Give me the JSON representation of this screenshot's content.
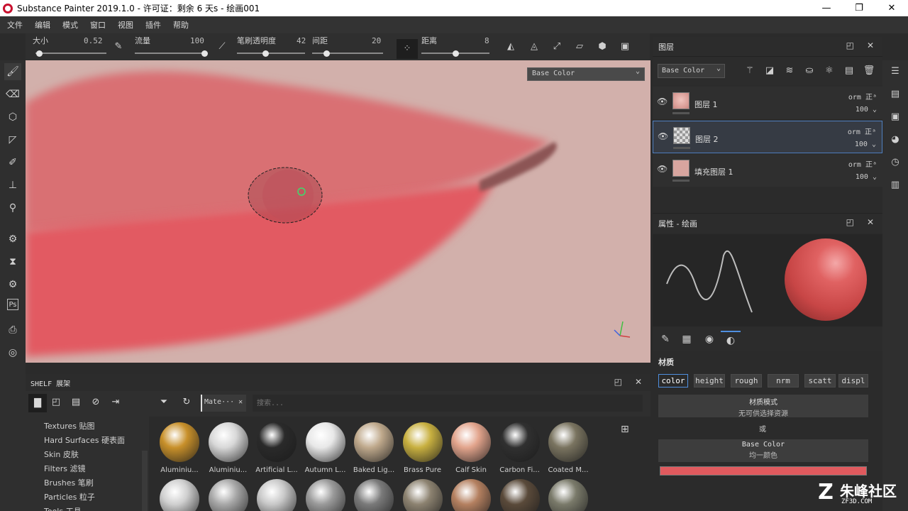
{
  "window": {
    "title": "Substance Painter 2019.1.0 - 许可证：剩余 6 天s - 绘画001",
    "minimize": "—",
    "restore": "❐",
    "close": "✕"
  },
  "menu": [
    "文件",
    "编辑",
    "模式",
    "窗口",
    "视图",
    "插件",
    "帮助"
  ],
  "toolbar": {
    "size_label": "大小",
    "size_value": "0.52",
    "flow_label": "流量",
    "flow_value": "100",
    "opacity_label": "笔刷透明度",
    "opacity_value": "42",
    "spacing_label": "间距",
    "spacing_value": "20",
    "distance_label": "距离",
    "distance_value": "8",
    "size_slider": 0.05,
    "flow_slider": 1.0,
    "opacity_slider": 0.42,
    "spacing_slider": 0.2,
    "distance_slider": 0.5
  },
  "viewport": {
    "channel": "Base Color"
  },
  "layers": {
    "title": "图层",
    "channel_select": "Base Color",
    "items": [
      {
        "name": "图层 1",
        "blend": "orm 正ᵃ",
        "opacity": "100 ⌄",
        "thumb": "face"
      },
      {
        "name": "图层 2",
        "blend": "orm 正ᵃ",
        "opacity": "100 ⌄",
        "thumb": "checker",
        "selected": true
      },
      {
        "name": "填充图层 1",
        "blend": "orm 正ᵃ",
        "opacity": "100 ⌄",
        "thumb": "face"
      }
    ]
  },
  "properties": {
    "title": "属性 - 绘画",
    "section": "材质",
    "channels": [
      "color",
      "height",
      "rough",
      "nrm",
      "scatt",
      "displ"
    ],
    "active_channel": "color",
    "material_mode_title": "材质模式",
    "material_mode_sub": "无可供选择资源",
    "or": "或",
    "base_color_title": "Base Color",
    "base_color_sub": "均一颜色",
    "swatch_color": "#e05a5e"
  },
  "shelf": {
    "title": "SHELF 展架",
    "filter_tag": "Mate··· ✕",
    "search_placeholder": "搜索...",
    "tree": [
      "Textures 贴图",
      "Hard Surfaces 硬表面",
      "Skin 皮肤",
      "Filters 滤镜",
      "Brushes 笔刷",
      "Particles 粒子",
      "Tools 工具"
    ],
    "assets_row1": [
      "Aluminiu...",
      "Aluminiu...",
      "Artificial L...",
      "Autumn L...",
      "Baked Lig...",
      "Brass Pure",
      "Calf Skin",
      "Carbon Fi...",
      "Coated M..."
    ],
    "asset_colors_row1": [
      "#c8902a",
      "#d8d8d8",
      "#2a2a2a",
      "#e8e8e8",
      "#bfa98c",
      "#c8b040",
      "#e2a48c",
      "#303030",
      "#7a7460"
    ],
    "asset_colors_row2": [
      "#cfcfcf",
      "#a8a8a8",
      "#c8c8c8",
      "#9a9a9a",
      "#7a7a7a",
      "#8c8270",
      "#b48060",
      "#5a4a3a",
      "#7a7a6a"
    ]
  },
  "watermark": {
    "logo": "Z",
    "text": "朱峰社区",
    "url": "ZF3D.COM"
  }
}
